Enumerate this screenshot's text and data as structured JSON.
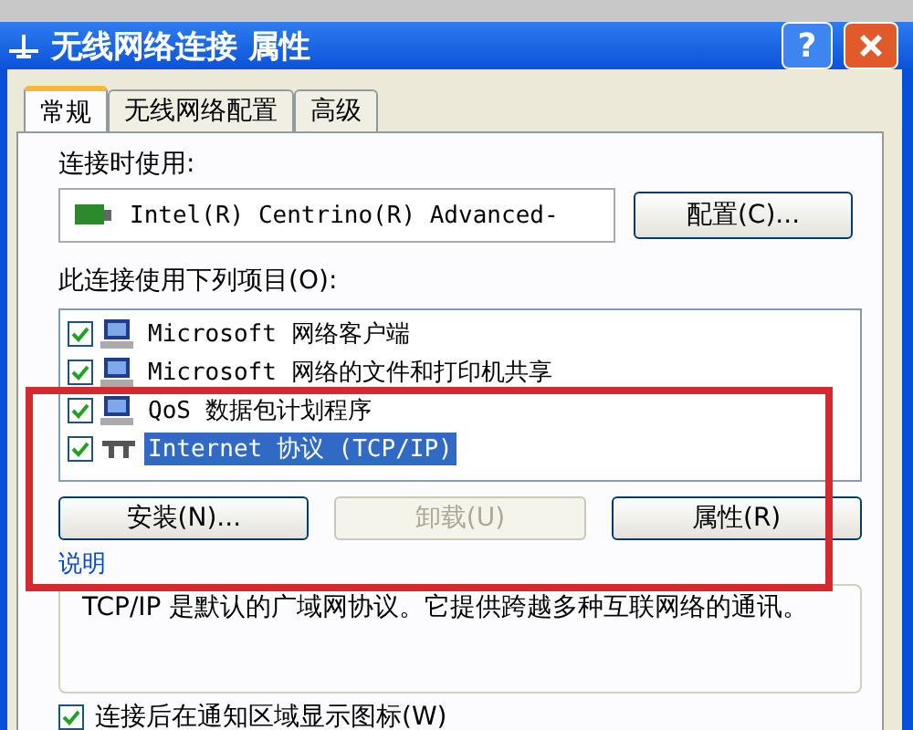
{
  "window": {
    "title": "无线网络连接 属性",
    "help": "?"
  },
  "tabs": [
    {
      "label": "常规",
      "selected": true
    },
    {
      "label": "无线网络配置",
      "selected": false
    },
    {
      "label": "高级",
      "selected": false
    }
  ],
  "connect_using": {
    "label": "连接时使用:",
    "device": "Intel(R) Centrino(R) Advanced-",
    "button": "配置(C)..."
  },
  "components": {
    "label": "此连接使用下列项目(O):",
    "items": [
      {
        "label": "Microsoft 网络客户端",
        "checked": true,
        "selected": false,
        "kind": "computer"
      },
      {
        "label": "Microsoft 网络的文件和打印机共享",
        "checked": true,
        "selected": false,
        "kind": "computer"
      },
      {
        "label": "QoS 数据包计划程序",
        "checked": true,
        "selected": false,
        "kind": "computer"
      },
      {
        "label": "Internet 协议 (TCP/IP)",
        "checked": true,
        "selected": true,
        "kind": "protocol"
      }
    ]
  },
  "buttons": [
    {
      "label": "安装(N)...",
      "disabled": false
    },
    {
      "label": "卸载(U)",
      "disabled": true
    },
    {
      "label": "属性(R)",
      "disabled": false
    }
  ],
  "description": {
    "label": "说明",
    "text": "TCP/IP 是默认的广域网协议。它提供跨越多种互联网络的通讯。"
  },
  "notify_checkbox": {
    "label": "连接后在通知区域显示图标(W)",
    "checked": true
  }
}
